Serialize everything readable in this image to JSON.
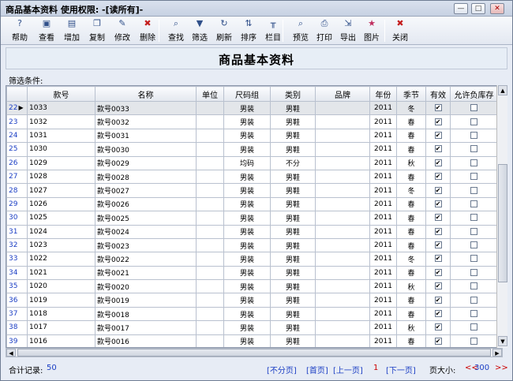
{
  "window": {
    "title": "商品基本资料   使用权限: -[读所有]-",
    "min_glyph": "—",
    "max_glyph": "□",
    "close_glyph": "✕"
  },
  "toolbar": [
    {
      "label": "帮助",
      "icon": "help-icon",
      "glyph": "?"
    },
    {
      "label": "查看",
      "icon": "view-icon",
      "glyph": "▣"
    },
    {
      "label": "增加",
      "icon": "add-icon",
      "glyph": "▤"
    },
    {
      "label": "复制",
      "icon": "copy-icon",
      "glyph": "❐"
    },
    {
      "label": "修改",
      "icon": "edit-icon",
      "glyph": "✎"
    },
    {
      "label": "删除",
      "icon": "delete-icon",
      "glyph": "✖"
    },
    {
      "label": "查找",
      "icon": "search-icon",
      "glyph": "⌕"
    },
    {
      "label": "筛选",
      "icon": "filter-icon",
      "glyph": "▼"
    },
    {
      "label": "刷新",
      "icon": "refresh-icon",
      "glyph": "↻"
    },
    {
      "label": "排序",
      "icon": "sort-icon",
      "glyph": "⇅"
    },
    {
      "label": "栏目",
      "icon": "columns-icon",
      "glyph": "╥"
    },
    {
      "label": "预览",
      "icon": "preview-icon",
      "glyph": "⌕"
    },
    {
      "label": "打印",
      "icon": "print-icon",
      "glyph": "⎙"
    },
    {
      "label": "导出",
      "icon": "export-icon",
      "glyph": "⇲"
    },
    {
      "label": "图片",
      "icon": "picture-icon",
      "glyph": "★"
    },
    {
      "label": "关闭",
      "icon": "close-icon",
      "glyph": "✖"
    }
  ],
  "header": {
    "title": "商品基本资料"
  },
  "filter": {
    "label": "筛选条件:"
  },
  "table": {
    "columns": [
      "款号",
      "名称",
      "单位",
      "尺码组",
      "类别",
      "品牌",
      "年份",
      "季节",
      "有效",
      "允许负库存"
    ],
    "sort_indicator": "▽",
    "row_marker": "▶",
    "check_glyph": "✔",
    "rows": [
      {
        "n": "22",
        "code": "1033",
        "name": "款号0033",
        "unit": "",
        "size": "男装",
        "cat": "男鞋",
        "brand": "",
        "year": "2011",
        "season": "冬",
        "valid": true,
        "neg": false
      },
      {
        "n": "23",
        "code": "1032",
        "name": "款号0032",
        "unit": "",
        "size": "男装",
        "cat": "男鞋",
        "brand": "",
        "year": "2011",
        "season": "春",
        "valid": true,
        "neg": false
      },
      {
        "n": "24",
        "code": "1031",
        "name": "款号0031",
        "unit": "",
        "size": "男装",
        "cat": "男鞋",
        "brand": "",
        "year": "2011",
        "season": "春",
        "valid": true,
        "neg": false
      },
      {
        "n": "25",
        "code": "1030",
        "name": "款号0030",
        "unit": "",
        "size": "男装",
        "cat": "男鞋",
        "brand": "",
        "year": "2011",
        "season": "春",
        "valid": true,
        "neg": false
      },
      {
        "n": "26",
        "code": "1029",
        "name": "款号0029",
        "unit": "",
        "size": "均码",
        "cat": "不分",
        "brand": "",
        "year": "2011",
        "season": "秋",
        "valid": true,
        "neg": false
      },
      {
        "n": "27",
        "code": "1028",
        "name": "款号0028",
        "unit": "",
        "size": "男装",
        "cat": "男鞋",
        "brand": "",
        "year": "2011",
        "season": "春",
        "valid": true,
        "neg": false
      },
      {
        "n": "28",
        "code": "1027",
        "name": "款号0027",
        "unit": "",
        "size": "男装",
        "cat": "男鞋",
        "brand": "",
        "year": "2011",
        "season": "冬",
        "valid": true,
        "neg": false
      },
      {
        "n": "29",
        "code": "1026",
        "name": "款号0026",
        "unit": "",
        "size": "男装",
        "cat": "男鞋",
        "brand": "",
        "year": "2011",
        "season": "春",
        "valid": true,
        "neg": false
      },
      {
        "n": "30",
        "code": "1025",
        "name": "款号0025",
        "unit": "",
        "size": "男装",
        "cat": "男鞋",
        "brand": "",
        "year": "2011",
        "season": "春",
        "valid": true,
        "neg": false
      },
      {
        "n": "31",
        "code": "1024",
        "name": "款号0024",
        "unit": "",
        "size": "男装",
        "cat": "男鞋",
        "brand": "",
        "year": "2011",
        "season": "春",
        "valid": true,
        "neg": false
      },
      {
        "n": "32",
        "code": "1023",
        "name": "款号0023",
        "unit": "",
        "size": "男装",
        "cat": "男鞋",
        "brand": "",
        "year": "2011",
        "season": "春",
        "valid": true,
        "neg": false
      },
      {
        "n": "33",
        "code": "1022",
        "name": "款号0022",
        "unit": "",
        "size": "男装",
        "cat": "男鞋",
        "brand": "",
        "year": "2011",
        "season": "冬",
        "valid": true,
        "neg": false
      },
      {
        "n": "34",
        "code": "1021",
        "name": "款号0021",
        "unit": "",
        "size": "男装",
        "cat": "男鞋",
        "brand": "",
        "year": "2011",
        "season": "春",
        "valid": true,
        "neg": false
      },
      {
        "n": "35",
        "code": "1020",
        "name": "款号0020",
        "unit": "",
        "size": "男装",
        "cat": "男鞋",
        "brand": "",
        "year": "2011",
        "season": "秋",
        "valid": true,
        "neg": false
      },
      {
        "n": "36",
        "code": "1019",
        "name": "款号0019",
        "unit": "",
        "size": "男装",
        "cat": "男鞋",
        "brand": "",
        "year": "2011",
        "season": "春",
        "valid": true,
        "neg": false
      },
      {
        "n": "37",
        "code": "1018",
        "name": "款号0018",
        "unit": "",
        "size": "男装",
        "cat": "男鞋",
        "brand": "",
        "year": "2011",
        "season": "春",
        "valid": true,
        "neg": false
      },
      {
        "n": "38",
        "code": "1017",
        "name": "款号0017",
        "unit": "",
        "size": "男装",
        "cat": "男鞋",
        "brand": "",
        "year": "2011",
        "season": "秋",
        "valid": true,
        "neg": false
      },
      {
        "n": "39",
        "code": "1016",
        "name": "款号0016",
        "unit": "",
        "size": "男装",
        "cat": "男鞋",
        "brand": "",
        "year": "2011",
        "season": "春",
        "valid": true,
        "neg": false
      }
    ]
  },
  "status": {
    "total_label": "合计记录:",
    "total": "50",
    "nopage": "[不分页]",
    "first": "[首页]",
    "prev": "[上一页]",
    "page": "1",
    "next": "[下一页]",
    "size_label": "页大小:",
    "size_prev": "<<",
    "size": "300",
    "size_next": ">>"
  }
}
